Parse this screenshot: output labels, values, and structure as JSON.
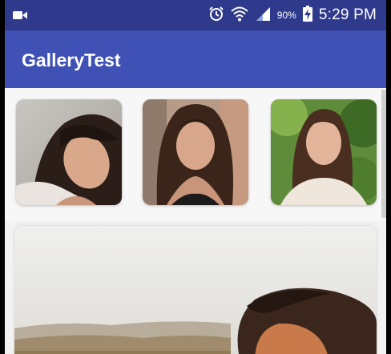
{
  "status_bar": {
    "battery_percent": "90%",
    "time": "5:29 PM",
    "icons": [
      "video-camera-icon",
      "alarm-clock-icon",
      "wifi-icon",
      "signal-icon",
      "battery-charging-icon"
    ]
  },
  "app_bar": {
    "title": "GalleryTest"
  },
  "gallery": {
    "thumbnails": [
      {
        "name": "thumbnail-1"
      },
      {
        "name": "thumbnail-2"
      },
      {
        "name": "thumbnail-3"
      }
    ]
  },
  "colors": {
    "status_bar": "#2f3a8c",
    "app_bar": "#3f51b5",
    "background": "#f2f2f2"
  }
}
